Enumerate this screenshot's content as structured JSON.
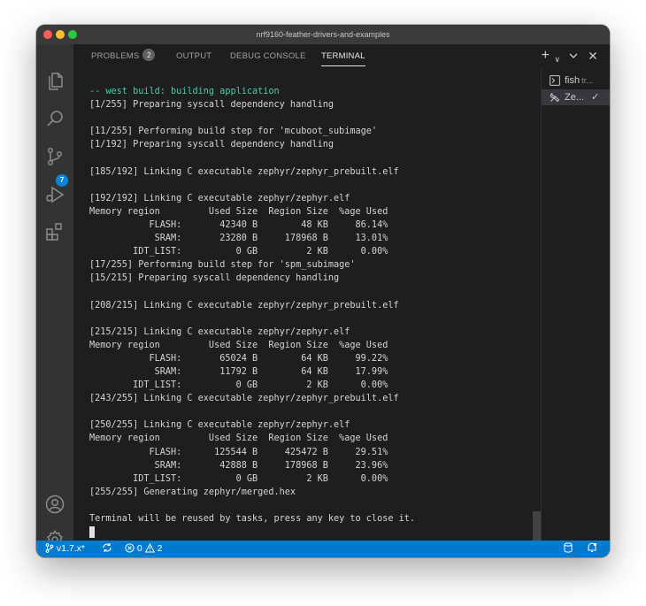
{
  "window": {
    "title": "nrf9160-feather-drivers-and-examples"
  },
  "activity_bar": {
    "items": [
      "explorer-icon",
      "search-icon",
      "source-control-icon",
      "run-debug-icon",
      "extensions-icon"
    ],
    "source_control_badge": "7",
    "bottom_items": [
      "account-icon",
      "settings-gear-icon"
    ]
  },
  "panel": {
    "tabs": [
      {
        "label": "PROBLEMS",
        "badge": "2"
      },
      {
        "label": "OUTPUT"
      },
      {
        "label": "DEBUG CONSOLE"
      },
      {
        "label": "TERMINAL",
        "active": true
      }
    ],
    "actions": [
      "add-terminal-icon",
      "dropdown-chevron-icon",
      "maximize-chevron-icon",
      "close-icon"
    ]
  },
  "terminal": {
    "lines": [
      "-- west build: building application",
      "[1/255] Preparing syscall dependency handling",
      "",
      "[11/255] Performing build step for 'mcuboot_subimage'",
      "[1/192] Preparing syscall dependency handling",
      "",
      "[185/192] Linking C executable zephyr/zephyr_prebuilt.elf",
      "",
      "[192/192] Linking C executable zephyr/zephyr.elf",
      "Memory region         Used Size  Region Size  %age Used",
      "           FLASH:       42340 B        48 KB     86.14%",
      "            SRAM:       23280 B     178968 B     13.01%",
      "        IDT_LIST:          0 GB         2 KB      0.00%",
      "[17/255] Performing build step for 'spm_subimage'",
      "[15/215] Preparing syscall dependency handling",
      "",
      "[208/215] Linking C executable zephyr/zephyr_prebuilt.elf",
      "",
      "[215/215] Linking C executable zephyr/zephyr.elf",
      "Memory region         Used Size  Region Size  %age Used",
      "           FLASH:       65024 B        64 KB     99.22%",
      "            SRAM:       11792 B        64 KB     17.99%",
      "        IDT_LIST:          0 GB         2 KB      0.00%",
      "[243/255] Linking C executable zephyr/zephyr_prebuilt.elf",
      "",
      "[250/255] Linking C executable zephyr/zephyr.elf",
      "Memory region         Used Size  Region Size  %age Used",
      "           FLASH:      125544 B     425472 B     29.51%",
      "            SRAM:       42888 B     178968 B     23.96%",
      "        IDT_LIST:          0 GB         2 KB      0.00%",
      "[255/255] Generating zephyr/merged.hex",
      "",
      "Terminal will be reused by tasks, press any key to close it."
    ]
  },
  "terminal_list": [
    {
      "icon": "terminal-icon",
      "name": "fish",
      "detail": "tr..."
    },
    {
      "icon": "tools-icon",
      "name": "Ze...",
      "status": "✓",
      "selected": true
    }
  ],
  "status_bar": {
    "branch": "v1.7.x*",
    "errors": "0",
    "warnings": "2"
  },
  "colors": {
    "status_bar": "#007acc",
    "terminal_bg": "#1e1e1e",
    "build_message": "#4ec9b0"
  }
}
